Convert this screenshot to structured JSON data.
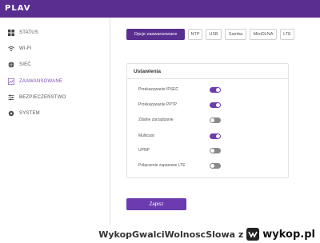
{
  "header": {
    "logo": "PLAV"
  },
  "sidebar": {
    "items": [
      {
        "label": "STATUS",
        "icon": "grid-icon",
        "active": false
      },
      {
        "label": "WI-FI",
        "icon": "wifi-icon",
        "active": false
      },
      {
        "label": "SIEĆ",
        "icon": "globe-icon",
        "active": false
      },
      {
        "label": "ZAAWANSOWANE",
        "icon": "chart-icon",
        "active": true
      },
      {
        "label": "BEZPIECZEŃSTWO",
        "icon": "shield-sliders-icon",
        "active": false
      },
      {
        "label": "SYSTEM",
        "icon": "gear-icon",
        "active": false
      }
    ]
  },
  "tabs": [
    {
      "label": "Opcje zaawansowane",
      "active": true
    },
    {
      "label": "NTP",
      "active": false
    },
    {
      "label": "USB",
      "active": false
    },
    {
      "label": "Samba",
      "active": false
    },
    {
      "label": "MiniDLNA",
      "active": false
    },
    {
      "label": "LTE",
      "active": false
    }
  ],
  "settings": {
    "title": "Ustawienia",
    "rows": [
      {
        "label": "Przekazywanie IPSEC",
        "enabled": true
      },
      {
        "label": "Przekazywanie PPTP",
        "enabled": true
      },
      {
        "label": "Zdalne zarządzanie",
        "enabled": false
      },
      {
        "label": "Multicast",
        "enabled": true
      },
      {
        "label": "UPNP",
        "enabled": false
      },
      {
        "label": "Połączenie zapasowe LTE",
        "enabled": false
      }
    ]
  },
  "save_label": "Zapisz",
  "watermark": {
    "text": "WykopGwalciWolnoscSlowa z",
    "site": "wykop.pl"
  },
  "colors": {
    "brand": "#5a2d91",
    "accent": "#6c3bb0",
    "toggle_off": "#8a8a8a"
  }
}
